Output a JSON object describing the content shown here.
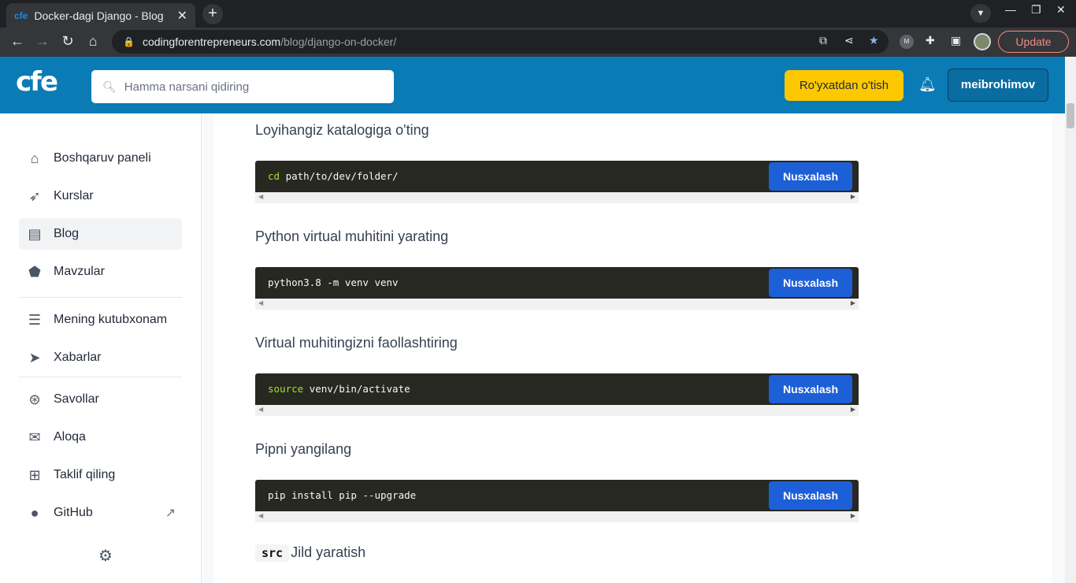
{
  "browser": {
    "tab_favicon": "cfe",
    "tab_title": "Docker-dagi Django - Blog",
    "close_glyph": "✕",
    "new_tab_glyph": "+",
    "url_host": "codingforentrepreneurs.com",
    "url_path": "/blog/django-on-docker/",
    "update_label": "Update",
    "extension_badge": "M"
  },
  "header": {
    "logo": "cfe",
    "search_placeholder": "Hamma narsani qidiring",
    "signup_label": "Ro'yxatdan o'tish",
    "username": "meibrohimov"
  },
  "sidebar": {
    "items": [
      {
        "label": "Boshqaruv paneli",
        "icon": "home-icon"
      },
      {
        "label": "Kurslar",
        "icon": "rocket-icon"
      },
      {
        "label": "Blog",
        "icon": "newspaper-icon"
      },
      {
        "label": "Mavzular",
        "icon": "tag-icon"
      },
      {
        "label": "Mening kutubxonam",
        "icon": "library-icon"
      },
      {
        "label": "Xabarlar",
        "icon": "send-icon"
      },
      {
        "label": "Savollar",
        "icon": "lifebuoy-icon"
      },
      {
        "label": "Aloqa",
        "icon": "mail-icon"
      },
      {
        "label": "Taklif qiling",
        "icon": "apps-add-icon"
      },
      {
        "label": "GitHub",
        "icon": "github-icon"
      }
    ],
    "active": "Blog"
  },
  "content": {
    "copy_label": "Nusxalash",
    "sections": [
      {
        "heading": "Loyihangiz katalogiga o'ting",
        "code_keyword": "cd",
        "code_rest": " path/to/dev/folder/"
      },
      {
        "heading": "Python virtual muhitini yarating",
        "code_keyword": "",
        "code_rest": "python3.8 -m venv venv"
      },
      {
        "heading": "Virtual muhitingizni faollashtiring",
        "code_keyword": "source",
        "code_rest": " venv/bin/activate"
      },
      {
        "heading": "Pipni yangilang",
        "code_keyword": "",
        "code_rest": "pip install pip --upgrade"
      }
    ],
    "last_heading_code": "src",
    "last_heading_text": "Jild yaratish"
  },
  "colors": {
    "header_bg": "#0b7bb5",
    "signup_bg": "#fdc800",
    "copy_button": "#1d5fd6",
    "code_bg": "#272822",
    "code_keyword": "#a6e22e"
  }
}
